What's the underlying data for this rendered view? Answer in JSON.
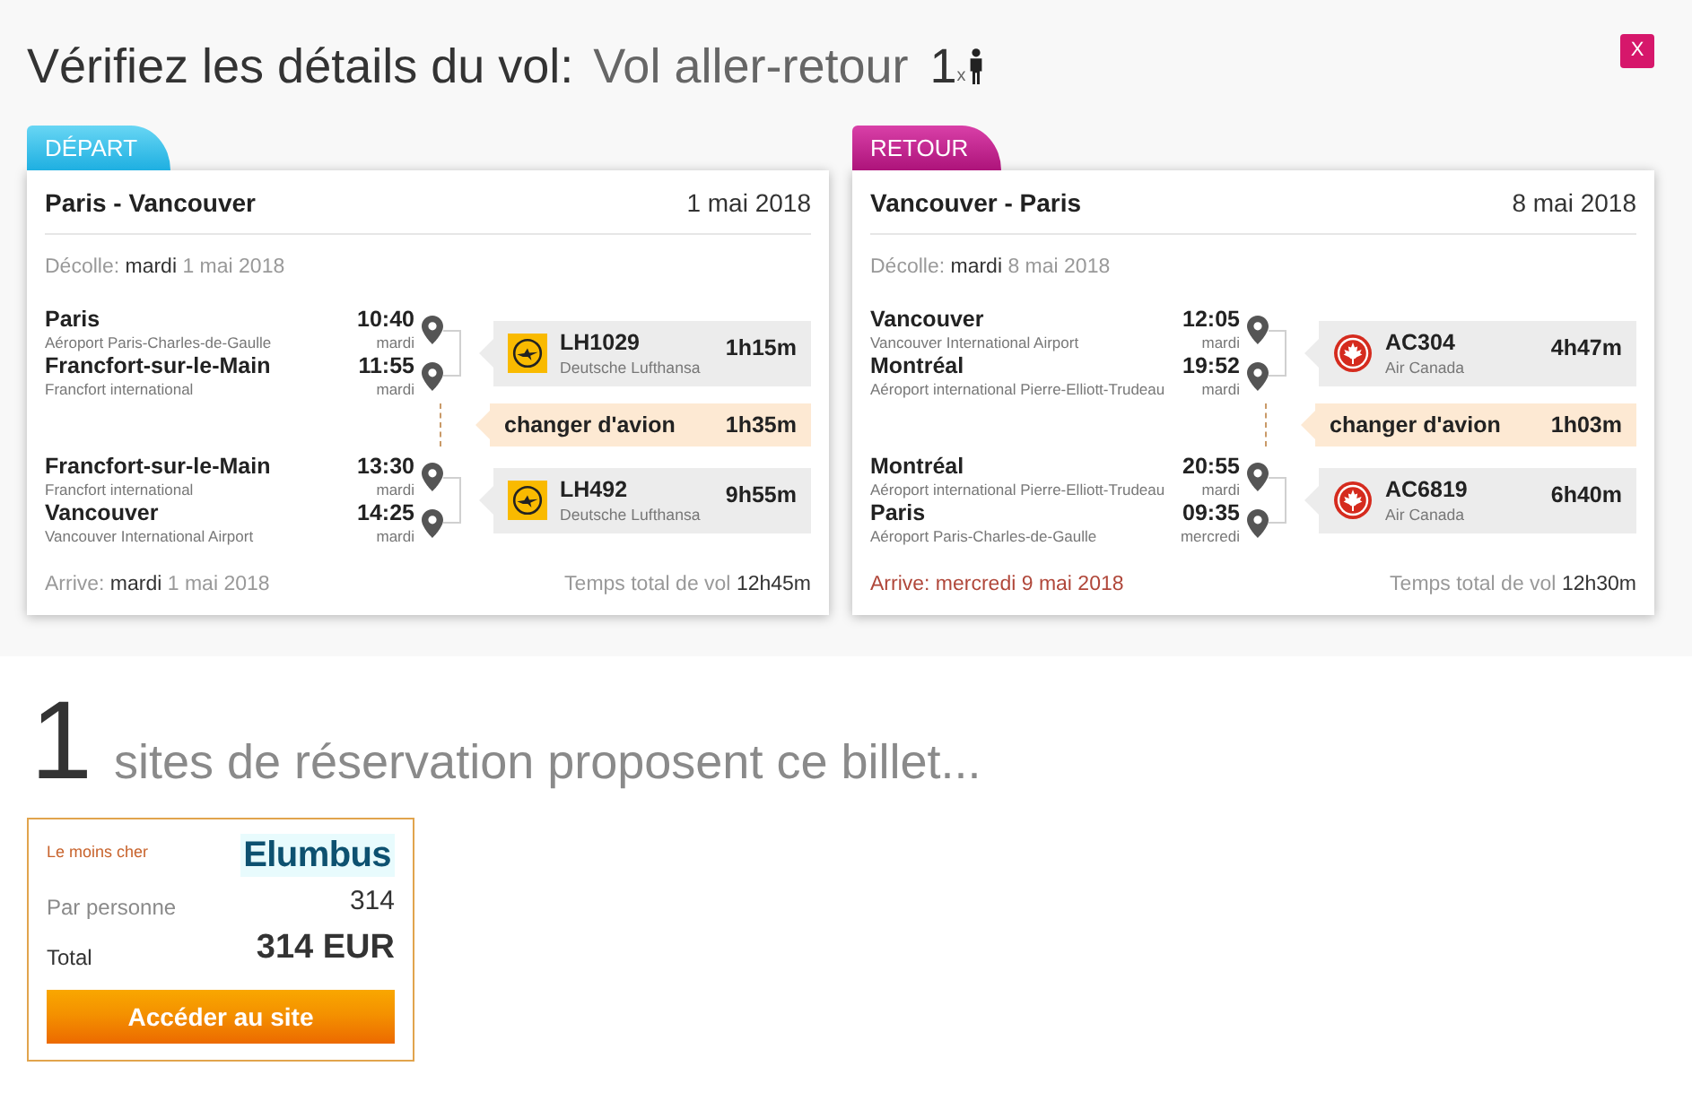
{
  "header": {
    "title": "Vérifiez les détails du vol:",
    "trip_type": "Vol aller-retour",
    "travellers": "1",
    "travellers_suffix": "x",
    "close_label": "X"
  },
  "legs": [
    {
      "tab": "DÉPART",
      "kind": "outbound",
      "route": "Paris - Vancouver",
      "date": "1 mai 2018",
      "departs": {
        "label": "Décolle:",
        "day": "mardi",
        "date": "1 mai 2018"
      },
      "segments": [
        {
          "kind": "flight",
          "from": {
            "city": "Paris",
            "time": "10:40",
            "airport": "Aéroport Paris-Charles-de-Gaulle",
            "day": "mardi"
          },
          "to": {
            "city": "Francfort-sur-le-Main",
            "time": "11:55",
            "airport": "Francfort international",
            "day": "mardi"
          },
          "flight": "LH1029",
          "airline": "Deutsche Lufthansa",
          "logo": {
            "kind": "crane"
          },
          "duration": "1h15m"
        },
        {
          "kind": "connection",
          "label": "changer d'avion",
          "duration": "1h35m"
        },
        {
          "kind": "flight",
          "from": {
            "city": "Francfort-sur-le-Main",
            "time": "13:30",
            "airport": "Francfort international",
            "day": "mardi"
          },
          "to": {
            "city": "Vancouver",
            "time": "14:25",
            "airport": "Vancouver International Airport",
            "day": "mardi"
          },
          "flight": "LH492",
          "airline": "Deutsche Lufthansa",
          "logo": {
            "kind": "crane"
          },
          "duration": "9h55m"
        }
      ],
      "arrives": {
        "label": "Arrive:",
        "day": "mardi",
        "date": "1 mai 2018",
        "next_day": false
      },
      "total": {
        "label": "Temps total de vol",
        "value": "12h45m"
      }
    },
    {
      "tab": "RETOUR",
      "kind": "return",
      "route": "Vancouver - Paris",
      "date": "8 mai 2018",
      "departs": {
        "label": "Décolle:",
        "day": "mardi",
        "date": "8 mai 2018"
      },
      "segments": [
        {
          "kind": "flight",
          "from": {
            "city": "Vancouver",
            "time": "12:05",
            "airport": "Vancouver International Airport",
            "day": "mardi"
          },
          "to": {
            "city": "Montréal",
            "time": "19:52",
            "airport": "Aéroport international Pierre-Elliott-Trudeau",
            "day": "mardi"
          },
          "flight": "AC304",
          "airline": "Air Canada",
          "logo": {
            "kind": "leaf"
          },
          "duration": "4h47m"
        },
        {
          "kind": "connection",
          "label": "changer d'avion",
          "duration": "1h03m"
        },
        {
          "kind": "flight",
          "from": {
            "city": "Montréal",
            "time": "20:55",
            "airport": "Aéroport international Pierre-Elliott-Trudeau",
            "day": "mardi"
          },
          "to": {
            "city": "Paris",
            "time": "09:35",
            "airport": "Aéroport Paris-Charles-de-Gaulle",
            "day": "mercredi"
          },
          "flight": "AC6819",
          "airline": "Air Canada",
          "logo": {
            "kind": "leaf"
          },
          "duration": "6h40m"
        }
      ],
      "arrives": {
        "label": "Arrive:",
        "day": "mercredi",
        "date": "9 mai 2018",
        "next_day": true
      },
      "total": {
        "label": "Temps total de vol",
        "value": "12h30m"
      }
    }
  ],
  "offers_heading": {
    "count": "1",
    "text": "sites de réservation proposent ce billet..."
  },
  "offers": [
    {
      "badge": "Le moins cher",
      "site": "Elumbus",
      "per_person_label": "Par personne",
      "per_person": "314",
      "total_label": "Total",
      "total": "314 EUR",
      "button": "Accéder au site"
    }
  ]
}
